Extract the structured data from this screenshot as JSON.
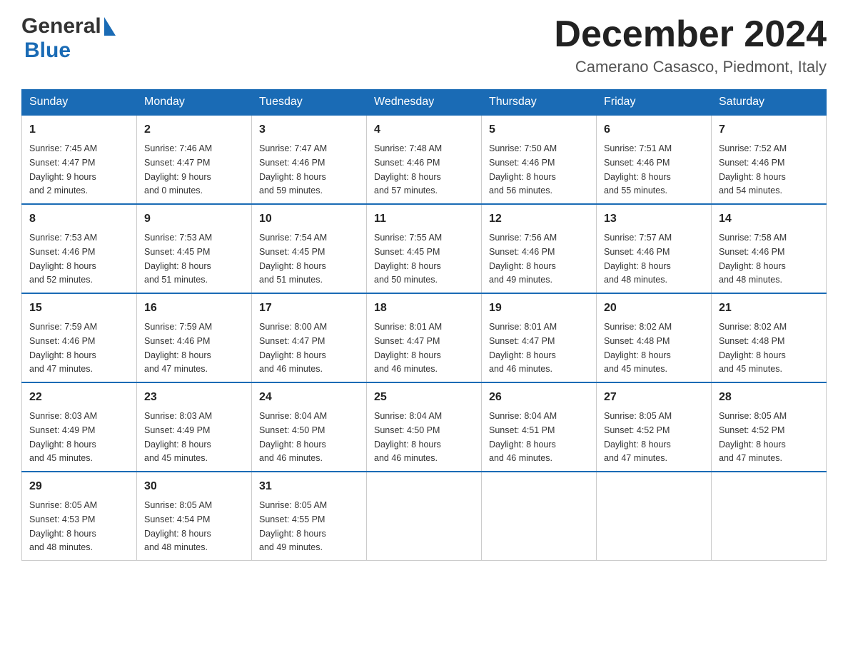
{
  "logo": {
    "general": "General",
    "flag_symbol": "▲",
    "blue": "Blue"
  },
  "title": "December 2024",
  "subtitle": "Camerano Casasco, Piedmont, Italy",
  "days_of_week": [
    "Sunday",
    "Monday",
    "Tuesday",
    "Wednesday",
    "Thursday",
    "Friday",
    "Saturday"
  ],
  "weeks": [
    [
      {
        "day": "1",
        "sunrise": "7:45 AM",
        "sunset": "4:47 PM",
        "daylight": "9 hours and 2 minutes."
      },
      {
        "day": "2",
        "sunrise": "7:46 AM",
        "sunset": "4:47 PM",
        "daylight": "9 hours and 0 minutes."
      },
      {
        "day": "3",
        "sunrise": "7:47 AM",
        "sunset": "4:46 PM",
        "daylight": "8 hours and 59 minutes."
      },
      {
        "day": "4",
        "sunrise": "7:48 AM",
        "sunset": "4:46 PM",
        "daylight": "8 hours and 57 minutes."
      },
      {
        "day": "5",
        "sunrise": "7:50 AM",
        "sunset": "4:46 PM",
        "daylight": "8 hours and 56 minutes."
      },
      {
        "day": "6",
        "sunrise": "7:51 AM",
        "sunset": "4:46 PM",
        "daylight": "8 hours and 55 minutes."
      },
      {
        "day": "7",
        "sunrise": "7:52 AM",
        "sunset": "4:46 PM",
        "daylight": "8 hours and 54 minutes."
      }
    ],
    [
      {
        "day": "8",
        "sunrise": "7:53 AM",
        "sunset": "4:46 PM",
        "daylight": "8 hours and 52 minutes."
      },
      {
        "day": "9",
        "sunrise": "7:53 AM",
        "sunset": "4:45 PM",
        "daylight": "8 hours and 51 minutes."
      },
      {
        "day": "10",
        "sunrise": "7:54 AM",
        "sunset": "4:45 PM",
        "daylight": "8 hours and 51 minutes."
      },
      {
        "day": "11",
        "sunrise": "7:55 AM",
        "sunset": "4:45 PM",
        "daylight": "8 hours and 50 minutes."
      },
      {
        "day": "12",
        "sunrise": "7:56 AM",
        "sunset": "4:46 PM",
        "daylight": "8 hours and 49 minutes."
      },
      {
        "day": "13",
        "sunrise": "7:57 AM",
        "sunset": "4:46 PM",
        "daylight": "8 hours and 48 minutes."
      },
      {
        "day": "14",
        "sunrise": "7:58 AM",
        "sunset": "4:46 PM",
        "daylight": "8 hours and 48 minutes."
      }
    ],
    [
      {
        "day": "15",
        "sunrise": "7:59 AM",
        "sunset": "4:46 PM",
        "daylight": "8 hours and 47 minutes."
      },
      {
        "day": "16",
        "sunrise": "7:59 AM",
        "sunset": "4:46 PM",
        "daylight": "8 hours and 47 minutes."
      },
      {
        "day": "17",
        "sunrise": "8:00 AM",
        "sunset": "4:47 PM",
        "daylight": "8 hours and 46 minutes."
      },
      {
        "day": "18",
        "sunrise": "8:01 AM",
        "sunset": "4:47 PM",
        "daylight": "8 hours and 46 minutes."
      },
      {
        "day": "19",
        "sunrise": "8:01 AM",
        "sunset": "4:47 PM",
        "daylight": "8 hours and 46 minutes."
      },
      {
        "day": "20",
        "sunrise": "8:02 AM",
        "sunset": "4:48 PM",
        "daylight": "8 hours and 45 minutes."
      },
      {
        "day": "21",
        "sunrise": "8:02 AM",
        "sunset": "4:48 PM",
        "daylight": "8 hours and 45 minutes."
      }
    ],
    [
      {
        "day": "22",
        "sunrise": "8:03 AM",
        "sunset": "4:49 PM",
        "daylight": "8 hours and 45 minutes."
      },
      {
        "day": "23",
        "sunrise": "8:03 AM",
        "sunset": "4:49 PM",
        "daylight": "8 hours and 45 minutes."
      },
      {
        "day": "24",
        "sunrise": "8:04 AM",
        "sunset": "4:50 PM",
        "daylight": "8 hours and 46 minutes."
      },
      {
        "day": "25",
        "sunrise": "8:04 AM",
        "sunset": "4:50 PM",
        "daylight": "8 hours and 46 minutes."
      },
      {
        "day": "26",
        "sunrise": "8:04 AM",
        "sunset": "4:51 PM",
        "daylight": "8 hours and 46 minutes."
      },
      {
        "day": "27",
        "sunrise": "8:05 AM",
        "sunset": "4:52 PM",
        "daylight": "8 hours and 47 minutes."
      },
      {
        "day": "28",
        "sunrise": "8:05 AM",
        "sunset": "4:52 PM",
        "daylight": "8 hours and 47 minutes."
      }
    ],
    [
      {
        "day": "29",
        "sunrise": "8:05 AM",
        "sunset": "4:53 PM",
        "daylight": "8 hours and 48 minutes."
      },
      {
        "day": "30",
        "sunrise": "8:05 AM",
        "sunset": "4:54 PM",
        "daylight": "8 hours and 48 minutes."
      },
      {
        "day": "31",
        "sunrise": "8:05 AM",
        "sunset": "4:55 PM",
        "daylight": "8 hours and 49 minutes."
      },
      null,
      null,
      null,
      null
    ]
  ],
  "labels": {
    "sunrise": "Sunrise:",
    "sunset": "Sunset:",
    "daylight": "Daylight:"
  }
}
